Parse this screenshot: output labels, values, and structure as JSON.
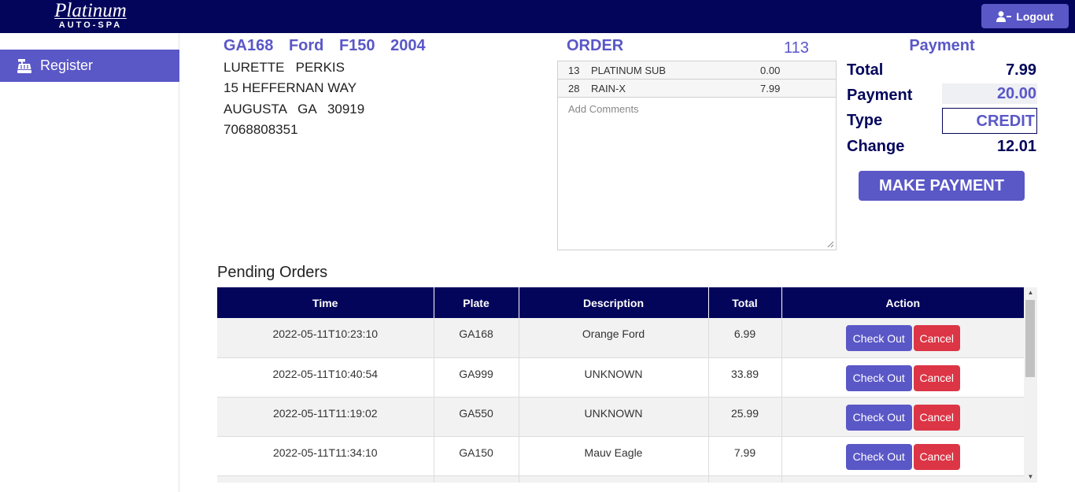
{
  "header": {
    "logo_main": "Platinum",
    "logo_sub": "AUTO-SPA",
    "logout_label": "Logout"
  },
  "sidebar": {
    "items": [
      {
        "label": "Register",
        "icon": "cash-register-icon"
      }
    ]
  },
  "vehicle": {
    "plate": "GA168",
    "make": "Ford",
    "model": "F150",
    "year": "2004"
  },
  "customer": {
    "name": "LURETTE   PERKIS",
    "address": "15 HEFFERNAN WAY",
    "city_state_zip": "AUGUSTA   GA   30919",
    "phone": "7068808351"
  },
  "order": {
    "title": "ORDER",
    "number": "113",
    "items": [
      {
        "qty": "13",
        "description": "PLATINUM SUB",
        "price": "0.00"
      },
      {
        "qty": "28",
        "description": "RAIN-X",
        "price": "7.99"
      }
    ],
    "comments_placeholder": "Add Comments"
  },
  "payment": {
    "title": "Payment",
    "total_label": "Total",
    "total_value": "7.99",
    "payment_label": "Payment",
    "payment_value": "20.00",
    "type_label": "Type",
    "type_value": "CREDIT",
    "change_label": "Change",
    "change_value": "12.01",
    "make_payment_label": "MAKE PAYMENT"
  },
  "pending": {
    "title": "Pending Orders",
    "columns": [
      "Time",
      "Plate",
      "Description",
      "Total",
      "Action"
    ],
    "checkout_label": "Check Out",
    "cancel_label": "Cancel",
    "rows": [
      {
        "time": "2022-05-11T10:23:10",
        "plate": "GA168",
        "description": "Orange Ford",
        "total": "6.99"
      },
      {
        "time": "2022-05-11T10:40:54",
        "plate": "GA999",
        "description": "UNKNOWN",
        "total": "33.89"
      },
      {
        "time": "2022-05-11T11:19:02",
        "plate": "GA550",
        "description": "UNKNOWN",
        "total": "25.99"
      },
      {
        "time": "2022-05-11T11:34:10",
        "plate": "GA150",
        "description": "Mauv Eagle",
        "total": "7.99"
      },
      {
        "time": "",
        "plate": "",
        "description": "",
        "total": ""
      }
    ]
  },
  "colors": {
    "navy": "#03055b",
    "accent": "#5a57c7",
    "danger": "#dc3545"
  }
}
